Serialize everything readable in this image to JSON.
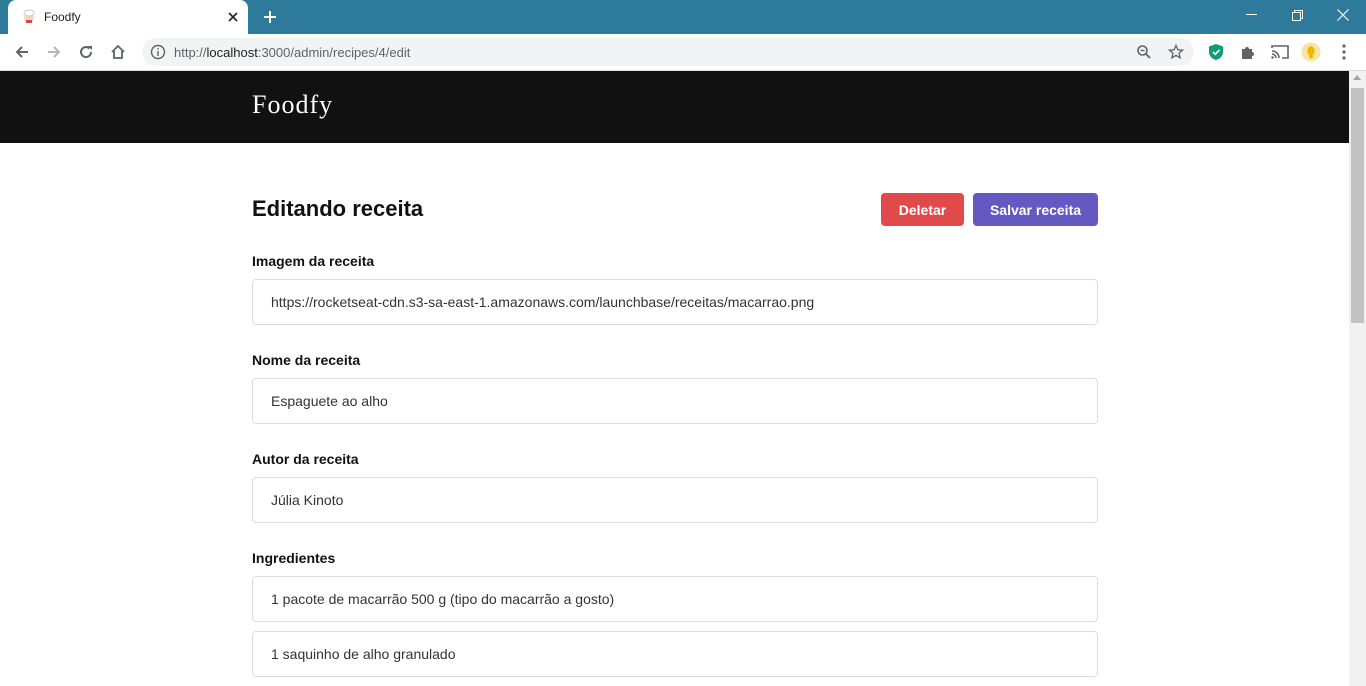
{
  "browser": {
    "tab_title": "Foodfy",
    "url_prefix": "http://",
    "url_host": "localhost",
    "url_path": ":3000/admin/recipes/4/edit",
    "titlebar_color": "#2e7a9a"
  },
  "header": {
    "logo": "Foodfy"
  },
  "page": {
    "title": "Editando receita",
    "delete_label": "Deletar",
    "save_label": "Salvar receita",
    "delete_color": "#e04a4b",
    "save_color": "#6558c3"
  },
  "form": {
    "image": {
      "label": "Imagem da receita",
      "value": "https://rocketseat-cdn.s3-sa-east-1.amazonaws.com/launchbase/receitas/macarrao.png"
    },
    "name": {
      "label": "Nome da receita",
      "value": "Espaguete ao alho"
    },
    "author": {
      "label": "Autor da receita",
      "value": "Júlia Kinoto"
    },
    "ingredients": {
      "label": "Ingredientes",
      "items": [
        "1 pacote de macarrão 500 g (tipo do macarrão a gosto)",
        "1 saquinho de alho granulado"
      ]
    }
  }
}
